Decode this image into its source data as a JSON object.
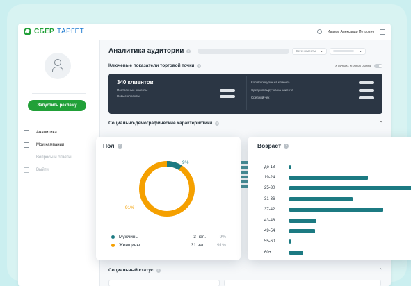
{
  "brand": {
    "name": "СБЕР",
    "suffix": "ТАРГЕТ",
    "accent": "#21a038"
  },
  "header": {
    "user_name": "Иванов Александр Петрович"
  },
  "sidebar": {
    "launch_button": "Запустить рекламу",
    "items": [
      {
        "label": "Аналитика",
        "icon": "analytics-icon",
        "active": true
      },
      {
        "label": "Мои кампании",
        "icon": "document-icon",
        "active": true
      },
      {
        "label": "Вопросы и ответы",
        "icon": "faq-icon",
        "active": false
      },
      {
        "label": "Выйти",
        "icon": "logout-icon",
        "active": false
      }
    ]
  },
  "main": {
    "title": "Аналитика аудитории",
    "segment_select": "Сеген сместы",
    "key_indicators": "Ключевые показатели торговой точки",
    "best_players_toggle": "У лучших игроков рынка",
    "clients_count": "340 клиентов",
    "regular_clients": "Постоянные клиенты",
    "new_clients": "Новые клиенты",
    "purchases_per_client": "Кол-во покупок на клиента",
    "avg_revenue": "Средняя выручка на клиента",
    "avg_check": "Средний чек",
    "socio_demo": "Социально-демографические характеристики",
    "social_status": "Социальный статус"
  },
  "gender_card": {
    "title": "Пол",
    "men_pct_label": "9%",
    "women_pct_label": "91%",
    "legend": [
      {
        "name": "Мужчины",
        "count": "3 чел.",
        "pct": "9%",
        "color": "#1c7a82"
      },
      {
        "name": "Женщины",
        "count": "31 чел.",
        "pct": "91%",
        "color": "#f5a000"
      }
    ]
  },
  "age_card": {
    "title": "Возраст",
    "bar_color": "#1c7a82"
  },
  "chart_data": [
    {
      "type": "pie",
      "title": "Пол",
      "categories": [
        "Мужчины",
        "Женщины"
      ],
      "values": [
        9,
        91
      ],
      "colors": [
        "#1c7a82",
        "#f5a000"
      ]
    },
    {
      "type": "bar",
      "title": "Возраст",
      "orientation": "horizontal",
      "categories": [
        "до 18",
        "19-24",
        "25-30",
        "31-36",
        "37-42",
        "43-48",
        "49-54",
        "55-60",
        "60+"
      ],
      "values": [
        1,
        61,
        100,
        49,
        73,
        21,
        20,
        1,
        11
      ]
    }
  ]
}
